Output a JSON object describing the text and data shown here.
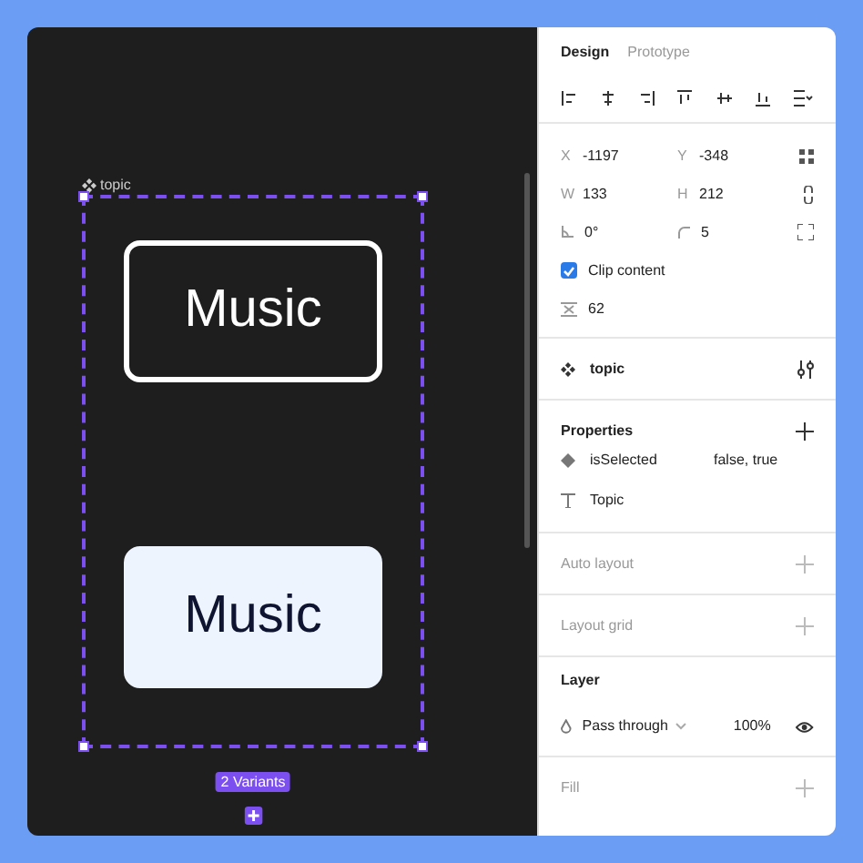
{
  "canvas": {
    "component_label": "topic",
    "variants": [
      {
        "label": "Music",
        "selected": false
      },
      {
        "label": "Music",
        "selected": true
      }
    ],
    "variants_badge": "2 Variants"
  },
  "panel": {
    "tabs": [
      {
        "label": "Design",
        "selected": true
      },
      {
        "label": "Prototype",
        "selected": false
      }
    ],
    "fields": [
      {
        "kind": "label",
        "label": "X",
        "value": "-1197"
      },
      {
        "kind": "label",
        "label": "Y",
        "value": "-348"
      },
      {
        "kind": "label",
        "label": "W",
        "value": "133"
      },
      {
        "kind": "label",
        "label": "H",
        "value": "212"
      },
      {
        "kind": "rotation",
        "value": "0°"
      },
      {
        "kind": "radius",
        "value": "5"
      }
    ],
    "clip_content": {
      "label": "Clip content",
      "checked": true
    },
    "spacing": "62",
    "component": {
      "name": "topic"
    },
    "sections": [
      {
        "kind": "properties",
        "title": "Properties",
        "items": [
          {
            "kind": "variant",
            "name": "isSelected",
            "value": "false, true"
          },
          {
            "kind": "text",
            "name": "Topic"
          }
        ]
      },
      {
        "kind": "empty",
        "title": "Auto layout"
      },
      {
        "kind": "empty",
        "title": "Layout grid"
      },
      {
        "kind": "layer",
        "title": "Layer",
        "blend": "Pass through",
        "opacity": "100%"
      },
      {
        "kind": "empty",
        "title": "Fill"
      }
    ]
  }
}
